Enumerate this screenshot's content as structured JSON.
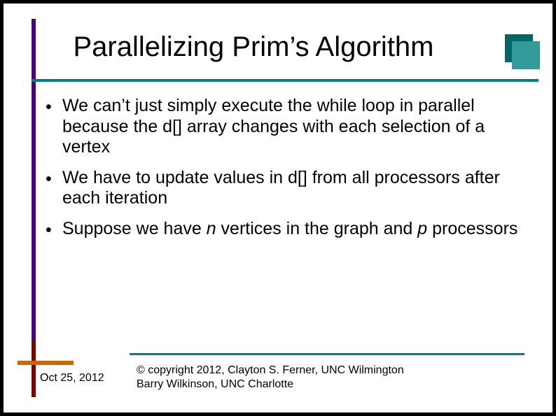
{
  "title": "Parallelizing Prim’s Algorithm",
  "bullets": [
    {
      "pre": "We can’t just simply execute the while loop in parallel because the d[] array changes with each selection of a vertex"
    },
    {
      "pre": "We have to update values in d[] from all processors after each iteration"
    },
    {
      "pre": "Suppose we have ",
      "em1": "n",
      "mid": " vertices in the graph and ",
      "em2": "p",
      "post": " processors"
    }
  ],
  "footer": {
    "date": "Oct 25, 2012",
    "copyright_l1": "© copyright 2012, Clayton S. Ferner, UNC Wilmington",
    "copyright_l2": "Barry Wilkinson, UNC Charlotte"
  }
}
